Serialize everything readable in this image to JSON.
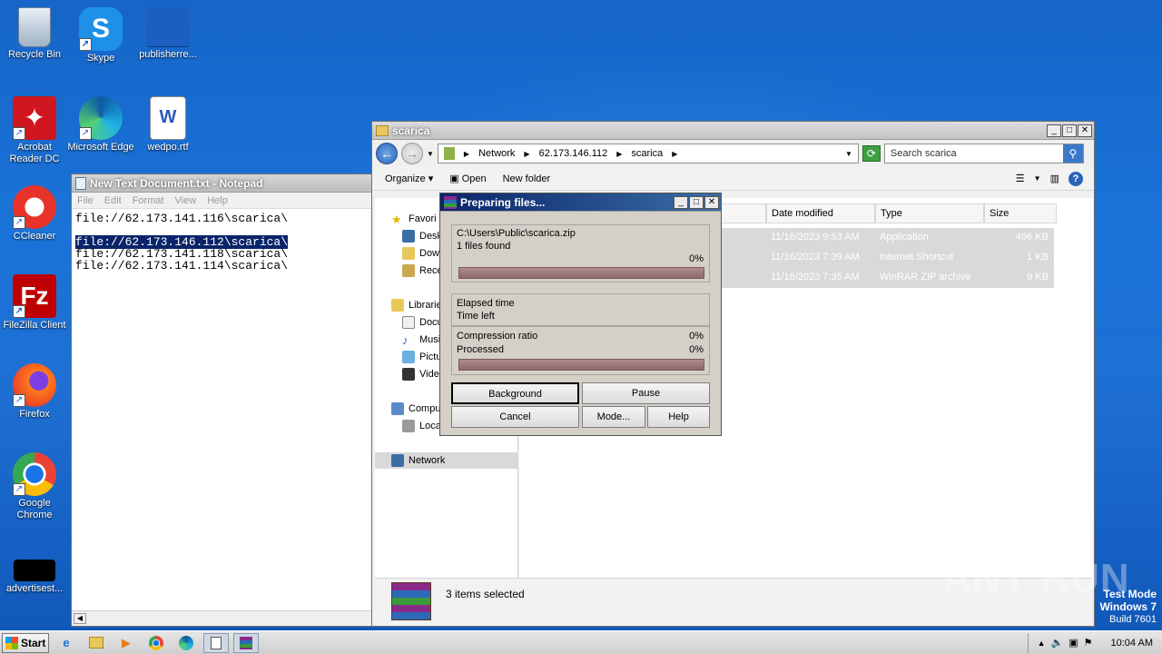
{
  "desktop": {
    "icons": [
      {
        "label": "Recycle Bin"
      },
      {
        "label": "Skype"
      },
      {
        "label": "publisherre..."
      },
      {
        "label": "Acrobat Reader DC"
      },
      {
        "label": "Microsoft Edge"
      },
      {
        "label": "wedpo.rtf"
      },
      {
        "label": "CCleaner"
      },
      {
        "label": "FileZilla Client"
      },
      {
        "label": "Firefox"
      },
      {
        "label": "Google Chrome"
      },
      {
        "label": "advertisest..."
      }
    ]
  },
  "notepad": {
    "title": "New Text Document.txt - Notepad",
    "menu": [
      "File",
      "Edit",
      "Format",
      "View",
      "Help"
    ],
    "lines": [
      "file://62.173.141.116\\scarica\\",
      "",
      "file://62.173.146.112\\scarica\\",
      "file://62.173.141.118\\scarica\\",
      "file://62.173.141.114\\scarica\\"
    ]
  },
  "explorer": {
    "title": "scarica",
    "address": [
      "Network",
      "62.173.146.112",
      "scarica"
    ],
    "search_placeholder": "Search scarica",
    "commands": {
      "organize": "Organize",
      "open": "Open",
      "new_folder": "New folder"
    },
    "nav": {
      "favorites": "Favori",
      "desktop": "Desk",
      "downloads": "Dow",
      "recent": "Rece",
      "libraries": "Librarie",
      "documents": "Docu",
      "music": "Musi",
      "pictures": "Pictu",
      "videos": "Video",
      "computer": "Compu",
      "local": "Loca",
      "network": "Network"
    },
    "columns": {
      "name": "",
      "date": "Date modified",
      "type": "Type",
      "size": "Size"
    },
    "files": [
      {
        "date": "11/16/2023 9:53 AM",
        "type": "Application",
        "size": "496 KB"
      },
      {
        "date": "11/16/2023 7:39 AM",
        "type": "Internet Shortcut",
        "size": "1 KB"
      },
      {
        "date": "11/16/2023 7:35 AM",
        "type": "WinRAR ZIP archive",
        "size": "9 KB"
      }
    ],
    "status": "3 items selected"
  },
  "rar_dialog": {
    "title": "Preparing files...",
    "path": "C:\\Users\\Public\\scarica.zip",
    "found": "1 files found",
    "percent_top": "0%",
    "elapsed_label": "Elapsed time",
    "left_label": "Time left",
    "compression_label": "Compression ratio",
    "compression_value": "0%",
    "processed_label": "Processed",
    "processed_value": "0%",
    "buttons": {
      "background": "Background",
      "pause": "Pause",
      "cancel": "Cancel",
      "mode": "Mode...",
      "help": "Help"
    }
  },
  "taskbar": {
    "start": "Start",
    "clock": "10:04 AM"
  },
  "watermark": "ANY RUN",
  "testmode": {
    "line1": "Test Mode",
    "line2": "Windows 7",
    "line3": "Build 7601"
  }
}
